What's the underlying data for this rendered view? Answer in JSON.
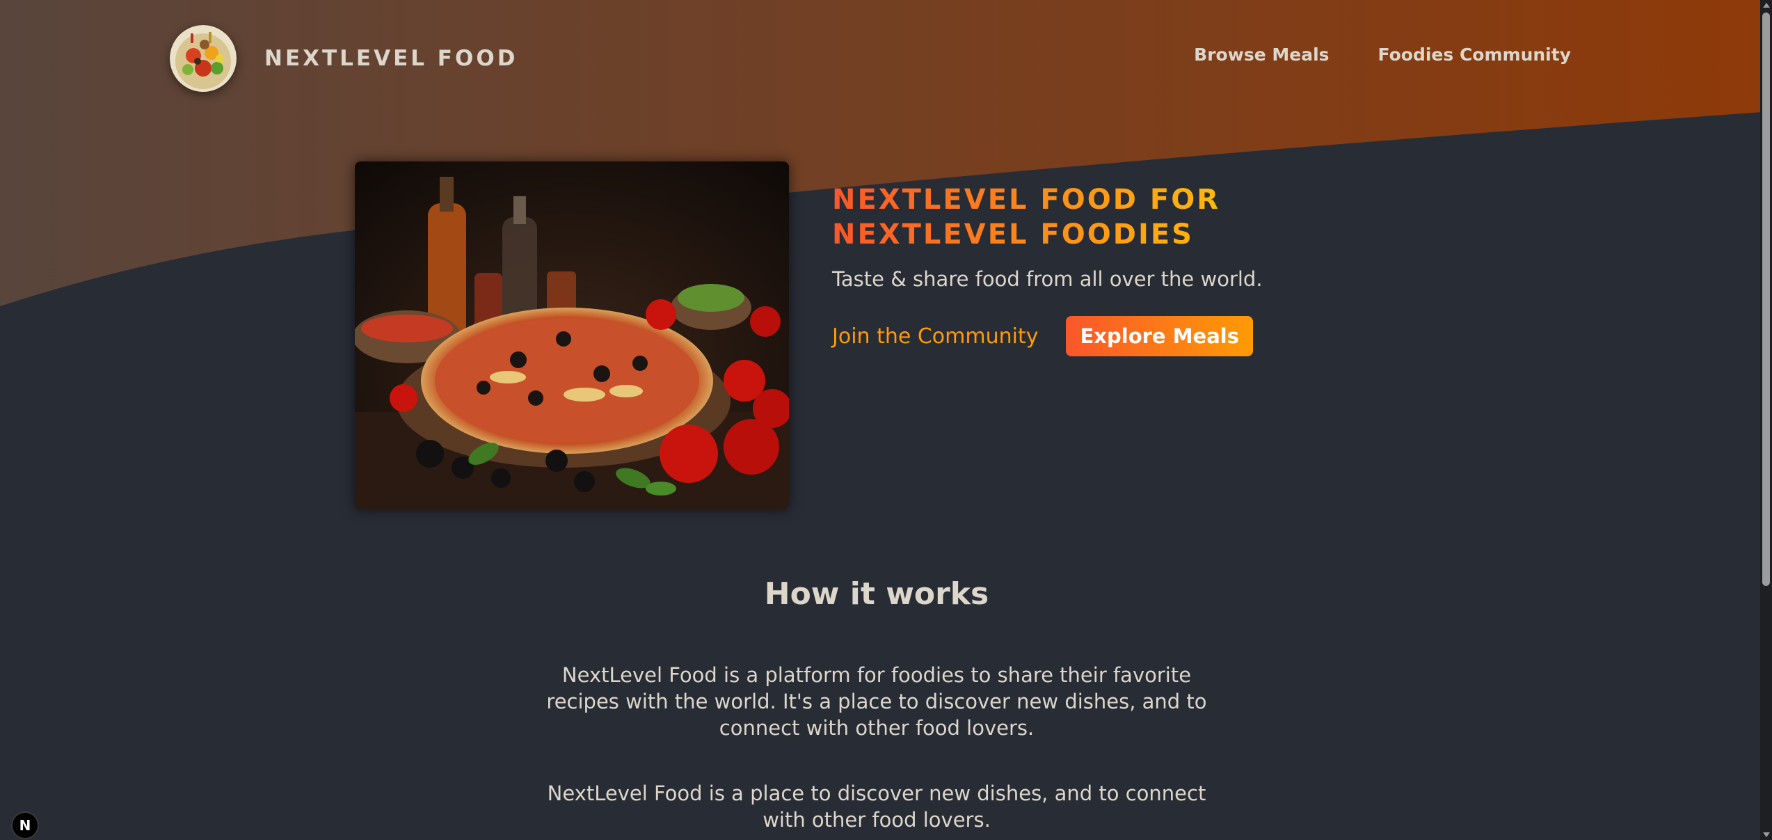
{
  "header": {
    "logo_text": "NEXTLEVEL FOOD",
    "logo_icon": "food-plate-logo",
    "nav": [
      {
        "label": "Browse Meals"
      },
      {
        "label": "Foodies Community"
      }
    ]
  },
  "hero": {
    "image_icon": "pizza-photo",
    "title_line1": "NEXTLEVEL FOOD FOR",
    "title_line2": "NEXTLEVEL FOODIES",
    "subtitle": "Taste & share food from all over the world.",
    "join_label": "Join the Community",
    "explore_label": "Explore Meals"
  },
  "how": {
    "heading": "How it works",
    "paragraph1": "NextLevel Food is a platform for foodies to share their favorite recipes with the world. It's a place to discover new dishes, and to connect with other food lovers.",
    "paragraph2": "NextLevel Food is a place to discover new dishes, and to connect with other food lovers."
  },
  "dev_badge": {
    "label": "N"
  },
  "colors": {
    "background": "#282c35",
    "header_gradient_start": "#59453c",
    "header_gradient_end": "#8f3a09",
    "accent_start": "#f9572a",
    "accent_end": "#ffc905",
    "text": "#ddd6cb"
  }
}
